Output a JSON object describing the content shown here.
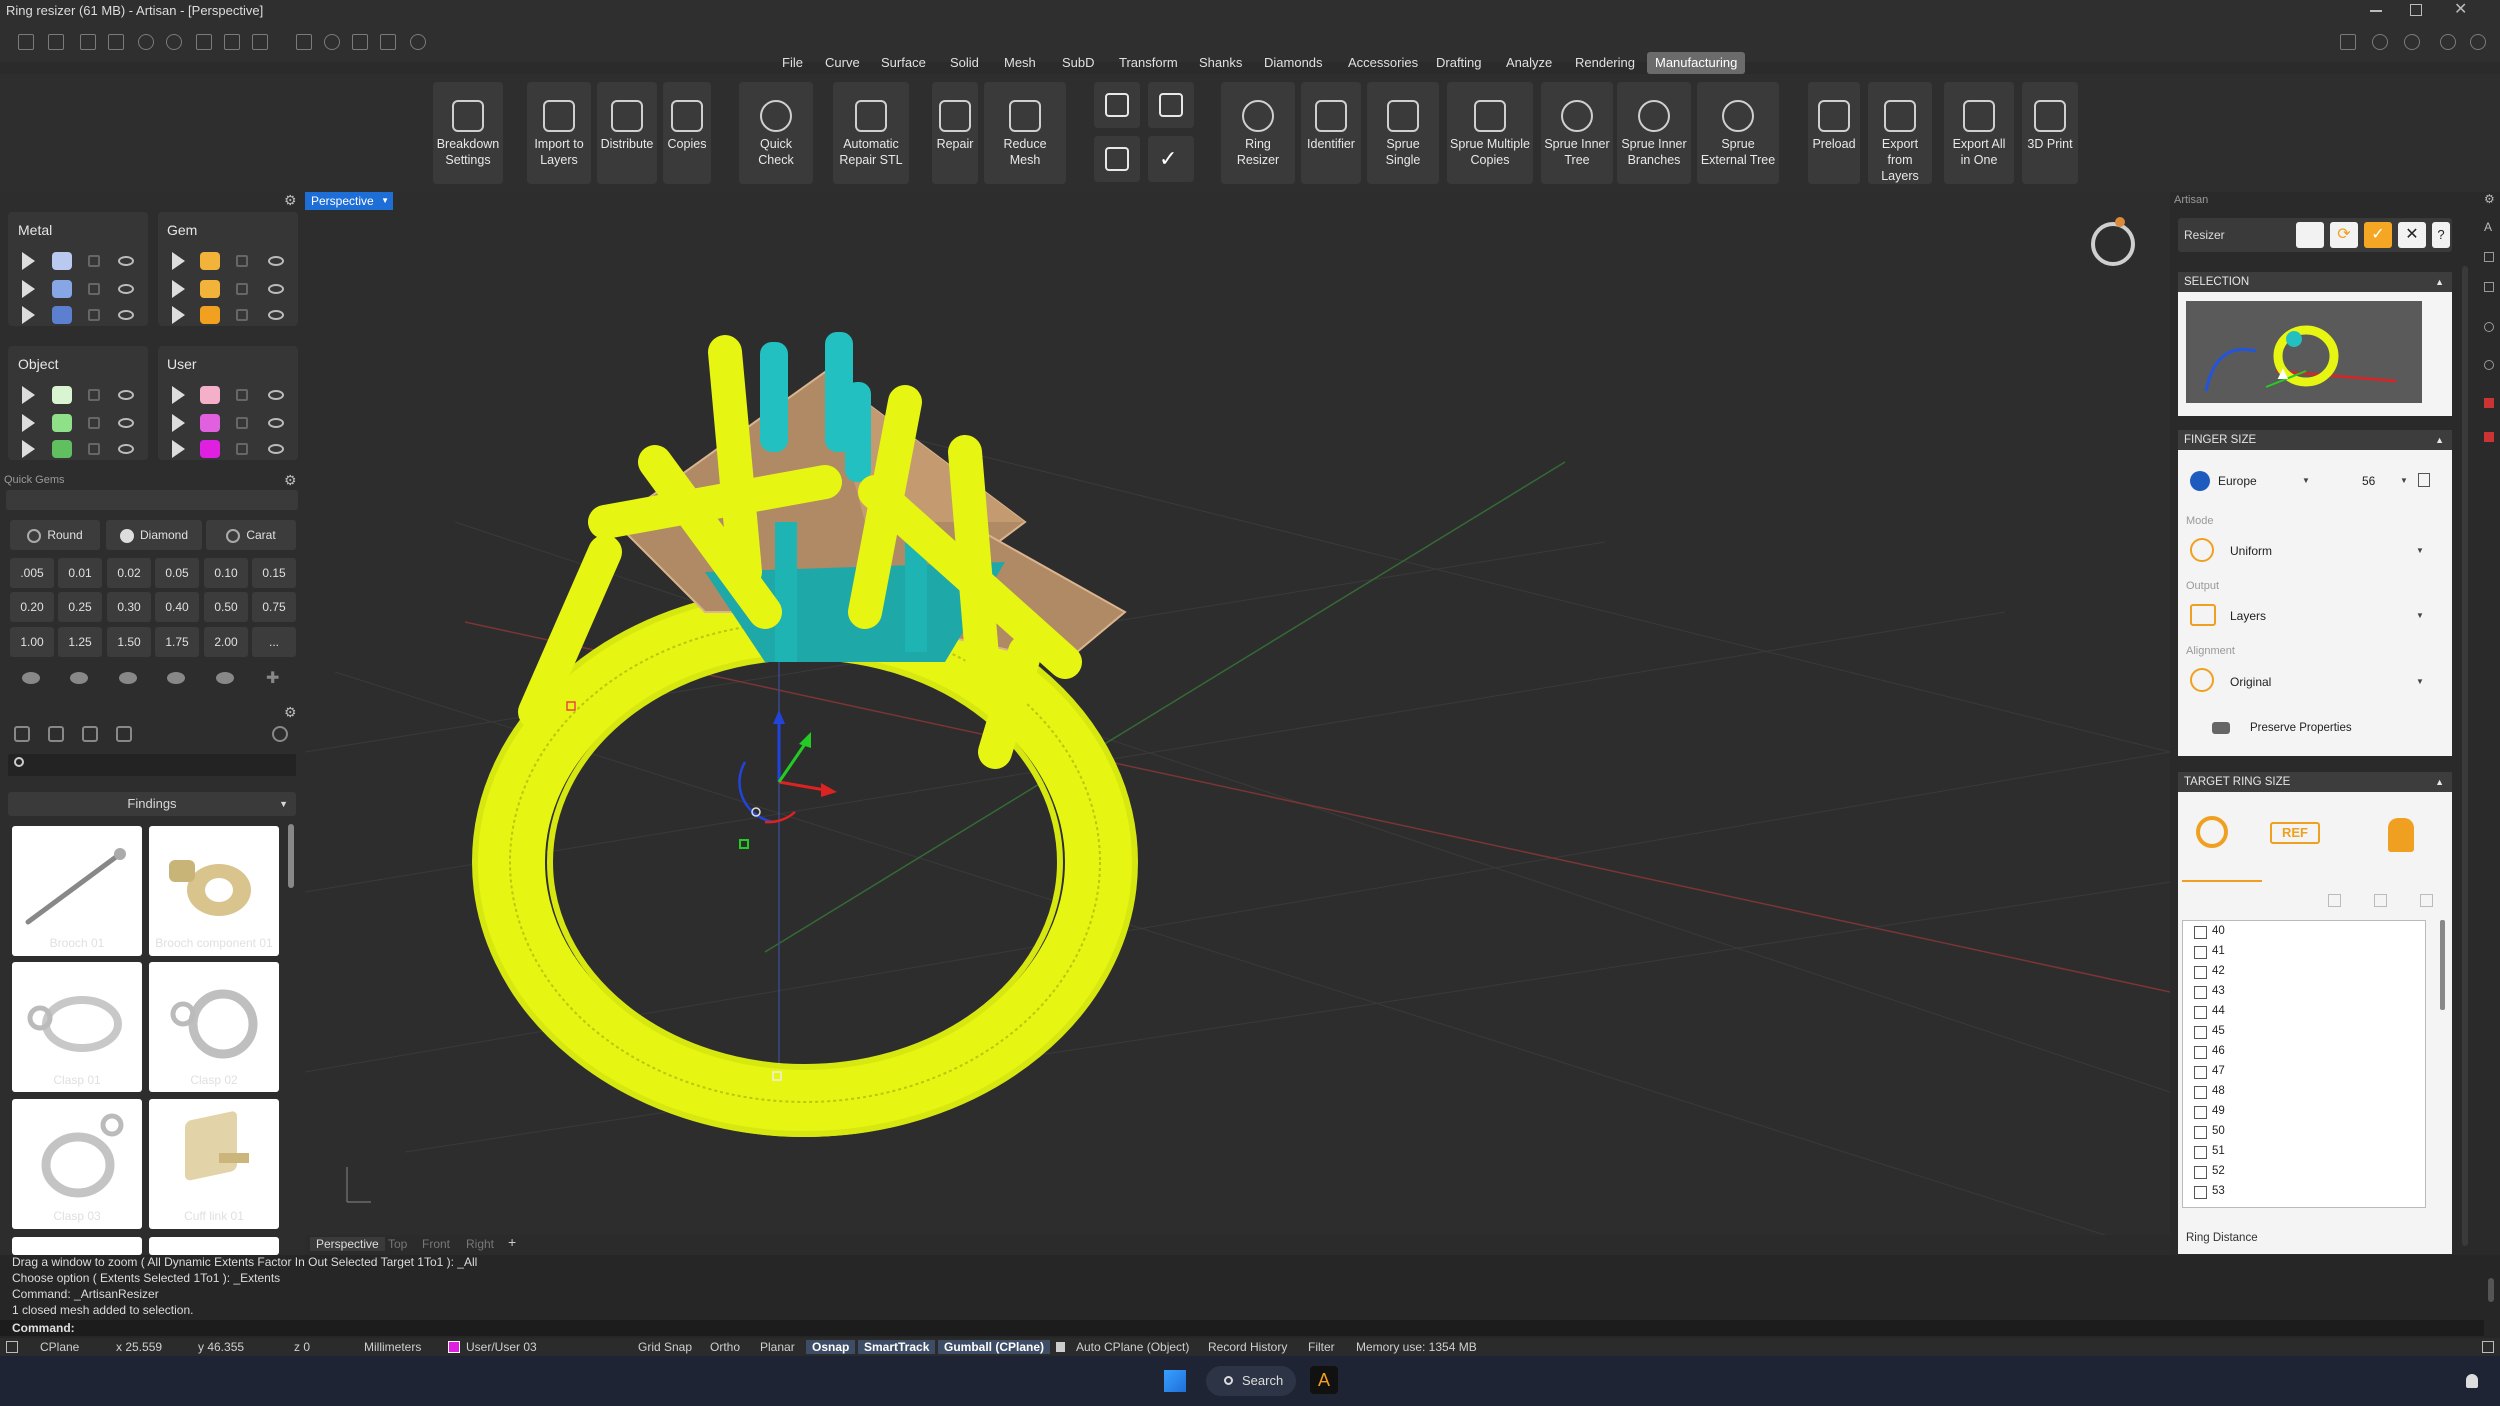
{
  "window": {
    "title": "Ring resizer (61 MB) - Artisan - [Perspective]"
  },
  "menu": [
    "File",
    "Curve",
    "Surface",
    "Solid",
    "Mesh",
    "SubD",
    "Transform",
    "Shanks",
    "Diamonds",
    "Accessories",
    "Drafting",
    "Analyze",
    "Rendering",
    "Manufacturing"
  ],
  "menu_active": "Manufacturing",
  "ribbon": {
    "breakdown": "Breakdown Settings",
    "import_layers": "Import to Layers",
    "distribute": "Distribute",
    "copies": "Copies",
    "quick_check": "Quick Check",
    "auto_repair": "Automatic Repair STL",
    "repair": "Repair",
    "reduce_mesh": "Reduce Mesh",
    "ring_resizer": "Ring Resizer",
    "identifier": "Identifier",
    "sprue_single": "Sprue Single",
    "sprue_multiple": "Sprue Multiple Copies",
    "sprue_inner_tree": "Sprue Inner Tree",
    "sprue_inner_branches": "Sprue Inner Branches",
    "sprue_external_tree": "Sprue External Tree",
    "preload": "Preload",
    "export_from_layers": "Export from Layers",
    "export_all": "Export All in One",
    "print3d": "3D Print"
  },
  "layers": {
    "metal": "Metal",
    "gem": "Gem",
    "object": "Object",
    "user": "User",
    "colors": {
      "metal": [
        "#b9c9f0",
        "#86a6e6",
        "#5c7fd0"
      ],
      "gem": [
        "#f2b33a",
        "#f2b33a",
        "#f2a020"
      ],
      "object": [
        "#d8f4d0",
        "#90e08a",
        "#60c060"
      ],
      "user": [
        "#f4b0c8",
        "#e060e0",
        "#e020e0"
      ]
    }
  },
  "quick_gems": {
    "title": "Quick Gems",
    "shape": "Round",
    "material": "Diamond",
    "unit": "Carat",
    "values": [
      ".005",
      "0.01",
      "0.02",
      "0.05",
      "0.10",
      "0.15",
      "0.20",
      "0.25",
      "0.30",
      "0.40",
      "0.50",
      "0.75",
      "1.00",
      "1.25",
      "1.50",
      "1.75",
      "2.00",
      "..."
    ]
  },
  "library": {
    "category": "Findings",
    "items": [
      "Brooch 01",
      "Brooch component 01",
      "Clasp 01",
      "Clasp 02",
      "Clasp 03",
      "Cuff link 01"
    ]
  },
  "viewport": {
    "name": "Perspective",
    "tabs": [
      "Perspective",
      "Top",
      "Front",
      "Right"
    ]
  },
  "right_panel": {
    "tab": "Artisan",
    "tool": "Resizer",
    "selection": "SELECTION",
    "finger_size": "FINGER SIZE",
    "region": "Europe",
    "size": "56",
    "mode_label": "Mode",
    "mode": "Uniform",
    "output_label": "Output",
    "output": "Layers",
    "alignment_label": "Alignment",
    "alignment": "Original",
    "preserve": "Preserve Properties",
    "target": "TARGET RING SIZE",
    "sizes": [
      "40",
      "41",
      "42",
      "43",
      "44",
      "45",
      "46",
      "47",
      "48",
      "49",
      "50",
      "51",
      "52",
      "53"
    ],
    "ring_distance": "Ring Distance"
  },
  "command": {
    "lines": [
      "Drag a window to zoom ( All  Dynamic  Extents  Factor  In  Out  Selected  Target  1To1 ): _All",
      "Choose option ( Extents  Selected  1To1 ): _Extents",
      "Command: _ArtisanResizer",
      "1 closed mesh added to selection."
    ],
    "prompt": "Command:"
  },
  "status": {
    "cplane": "CPlane",
    "x": "x 25.559",
    "y": "y 46.355",
    "z": "z 0",
    "units": "Millimeters",
    "layer": "User/User 03",
    "grid_snap": "Grid Snap",
    "ortho": "Ortho",
    "planar": "Planar",
    "osnap": "Osnap",
    "smarttrack": "SmartTrack",
    "gumball": "Gumball (CPlane)",
    "auto_cplane": "Auto CPlane (Object)",
    "record_history": "Record History",
    "filter": "Filter",
    "memory": "Memory use: 1354 MB"
  },
  "taskbar": {
    "search": "Search"
  }
}
